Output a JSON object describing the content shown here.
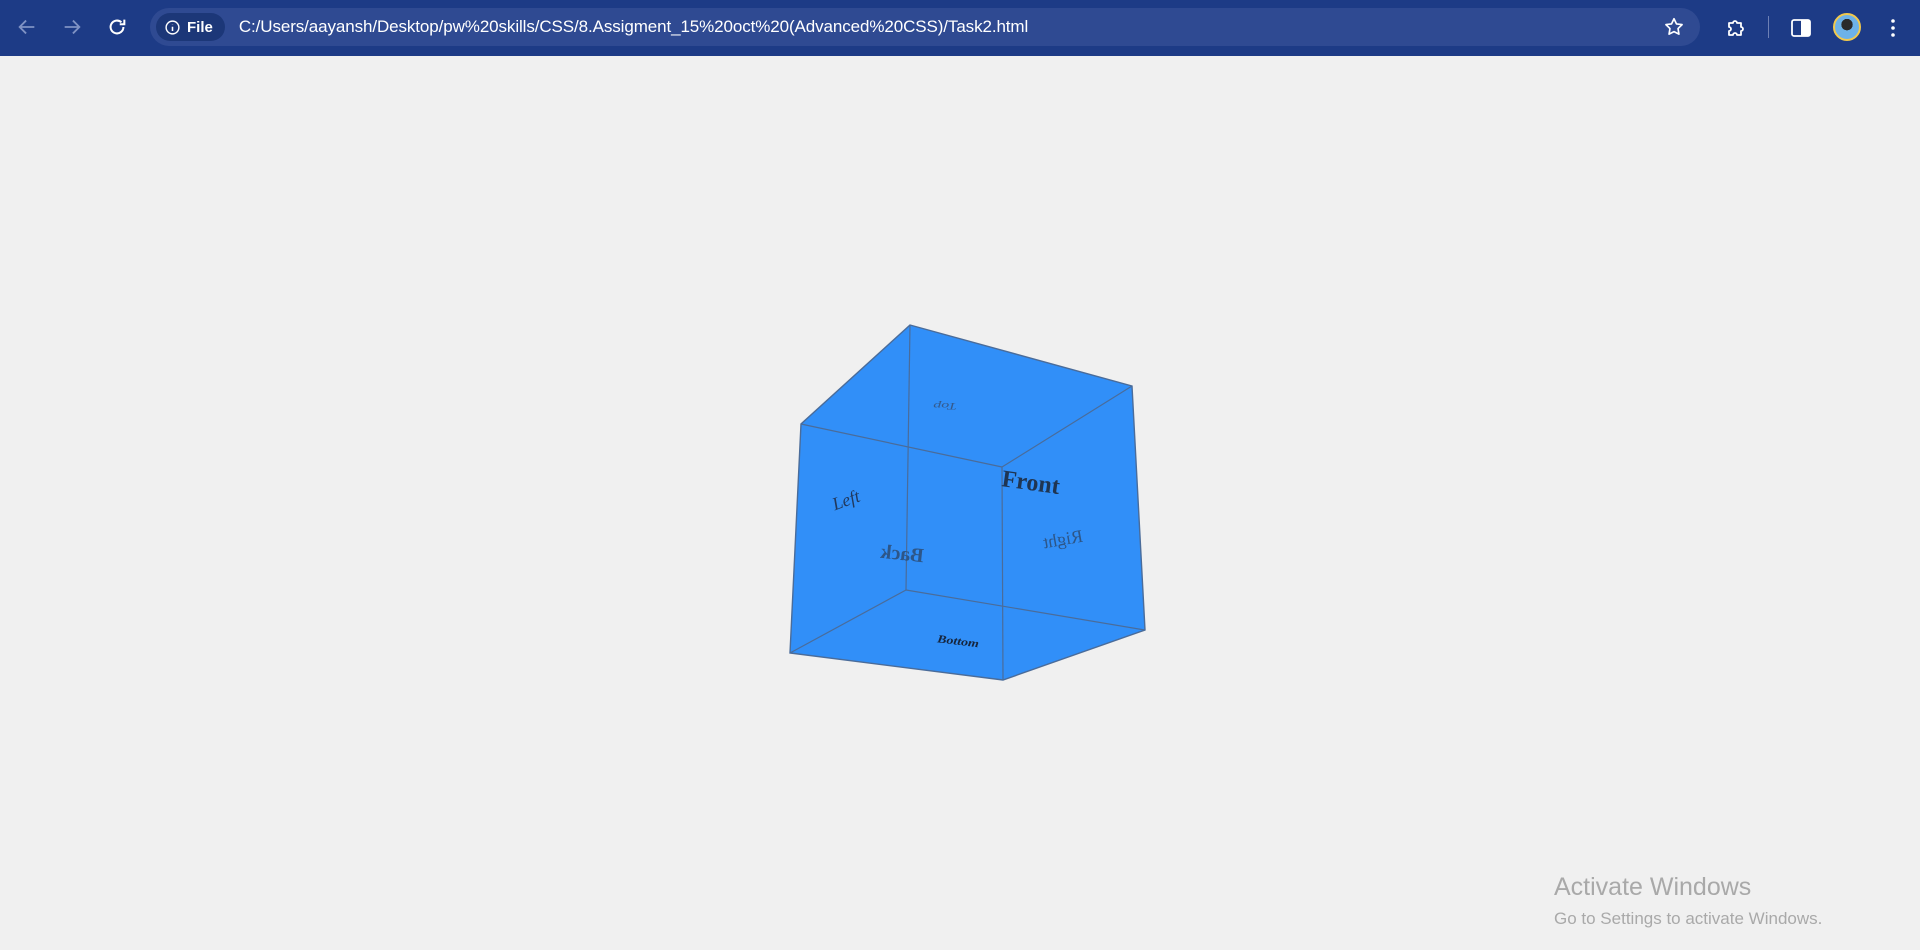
{
  "browser": {
    "site_chip_label": "File",
    "url": "C:/Users/aayansh/Desktop/pw%20skills/CSS/8.Assigment_15%20oct%20(Advanced%20CSS)/Task2.html",
    "icons": [
      "back-icon",
      "forward-icon",
      "reload-icon",
      "info-icon",
      "bookmark-star-icon",
      "extensions-icon",
      "side-panel-icon",
      "profile-avatar",
      "more-menu-icon"
    ]
  },
  "cube": {
    "face_color": "#318ff8",
    "edge_color": "#4a6c9a",
    "faces": {
      "front": "Front",
      "back": "Back",
      "left": "Left",
      "right": "Right",
      "top": "Top",
      "bottom": "Bottom"
    }
  },
  "watermark": {
    "title": "Activate Windows",
    "subtitle": "Go to Settings to activate Windows."
  }
}
